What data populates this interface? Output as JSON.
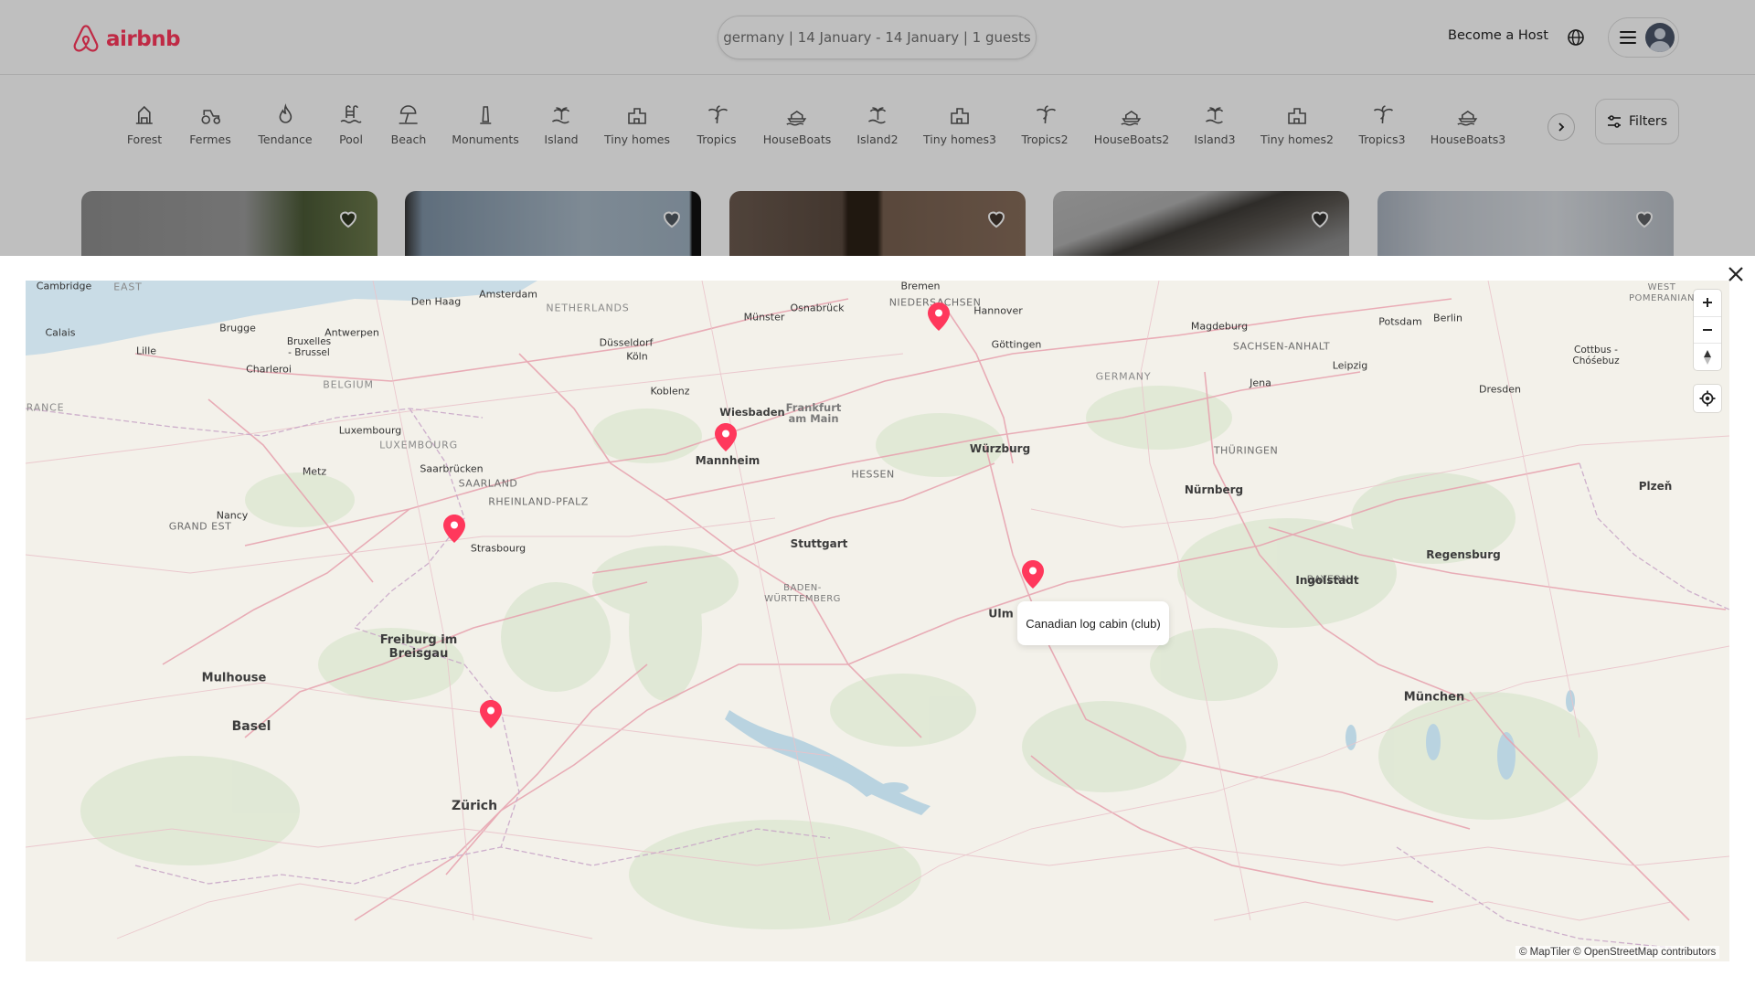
{
  "header": {
    "logo_text": "airbnb",
    "search_summary": "germany | 14 January - 14 January | 1 guests",
    "host_link": "Become a Host"
  },
  "categories": [
    {
      "label": "Forest",
      "icon": "forest-icon"
    },
    {
      "label": "Fermes",
      "icon": "tractor-icon"
    },
    {
      "label": "Tendance",
      "icon": "flame-icon"
    },
    {
      "label": "Pool",
      "icon": "pool-icon"
    },
    {
      "label": "Beach",
      "icon": "beach-icon"
    },
    {
      "label": "Monuments",
      "icon": "monument-icon"
    },
    {
      "label": "Island",
      "icon": "island-icon"
    },
    {
      "label": "Tiny homes",
      "icon": "tiny-home-icon"
    },
    {
      "label": "Tropics",
      "icon": "palm-icon"
    },
    {
      "label": "HouseBoats",
      "icon": "houseboat-icon"
    },
    {
      "label": "Island2",
      "icon": "island-icon"
    },
    {
      "label": "Tiny homes3",
      "icon": "tiny-home-icon"
    },
    {
      "label": "Tropics2",
      "icon": "palm-icon"
    },
    {
      "label": "HouseBoats2",
      "icon": "houseboat-icon"
    },
    {
      "label": "Island3",
      "icon": "island-icon"
    },
    {
      "label": "Tiny homes2",
      "icon": "tiny-home-icon"
    },
    {
      "label": "Tropics3",
      "icon": "palm-icon"
    },
    {
      "label": "HouseBoats3",
      "icon": "houseboat-icon"
    }
  ],
  "filters_label": "Filters",
  "map": {
    "tooltip": "Canadian log cabin (club)",
    "attribution": "© MapTiler © OpenStreetMap contributors",
    "cities": [
      "Cambridge",
      "Calais",
      "Lille",
      "Brugge",
      "Bruxelles\n- Brussel",
      "Antwerpen",
      "Den Haag",
      "Amsterdam",
      "Charleroi",
      "Luxembourg",
      "Metz",
      "Nancy",
      "Saarbrücken",
      "Strasbourg",
      "Koblenz",
      "Köln",
      "Düsseldorf",
      "Münster",
      "Osnabrück",
      "Bremen",
      "Hannover",
      "Göttingen",
      "Magdeburg",
      "Potsdam",
      "Berlin",
      "Leipzig",
      "Jena",
      "Dresden",
      "Cottbus -\nChóśebuz",
      "Frankfurt\nam Main",
      "Mannheim",
      "Würzburg",
      "Nürnberg",
      "Stuttgart",
      "Regensburg",
      "Ingolstadt",
      "Ulm",
      "München",
      "Freiburg im\nBreisgau",
      "Mulhouse",
      "Basel",
      "Zürich",
      "Plzeň",
      "Wiesbaden"
    ],
    "regions": [
      "BELGIUM",
      "LUXEMBOURG",
      "SAARLAND",
      "RHEINLAND-PFALZ",
      "HESSEN",
      "GERMANY",
      "THÜRINGEN",
      "BAYERN",
      "BADEN-\nWÜRTTEMBERG",
      "GRAND EST",
      "NETHERLANDS",
      "NIEDERSACHSEN",
      "SACHSEN-ANHALT",
      "FRANCE",
      "EAST",
      "WEST\nPOMERANIAN"
    ]
  }
}
